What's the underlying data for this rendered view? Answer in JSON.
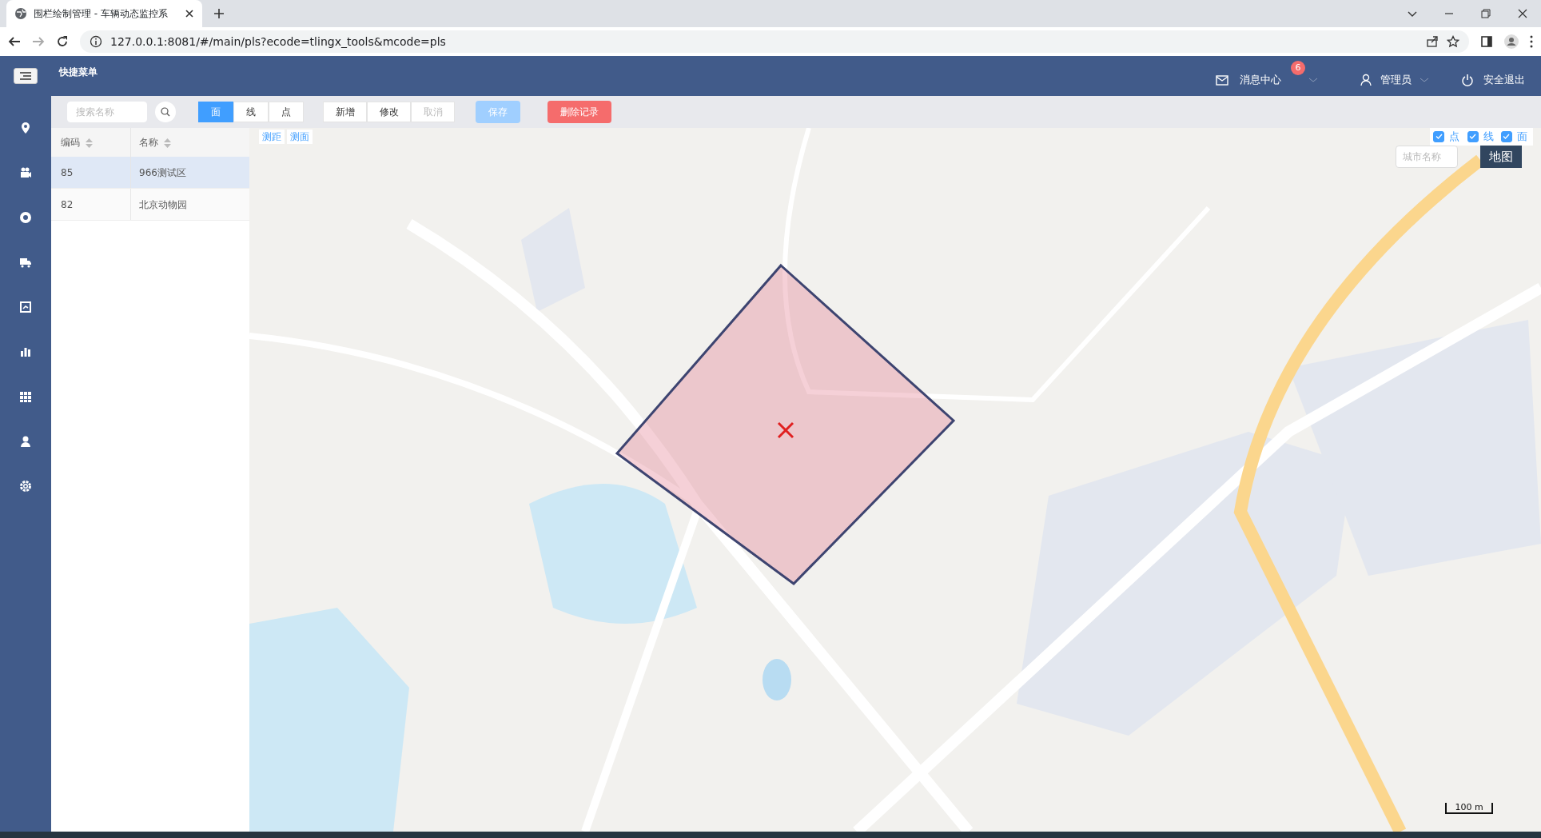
{
  "browser": {
    "tab_title": "围栏绘制管理 - 车辆动态监控系",
    "url": "127.0.0.1:8081/#/main/pls?ecode=tlingx_tools&mcode=pls"
  },
  "header": {
    "menu_title": "快捷菜单",
    "messages": {
      "label": "消息中心",
      "badge": "6"
    },
    "user": "管理员",
    "logout": "安全退出"
  },
  "toolbar": {
    "search": {
      "placeholder": "搜索名称"
    },
    "modes": [
      {
        "label": "面",
        "selected": true
      },
      {
        "label": "线",
        "selected": false
      },
      {
        "label": "点",
        "selected": false
      }
    ],
    "actions": [
      {
        "label": "新增",
        "disabled": false
      },
      {
        "label": "修改",
        "disabled": false
      },
      {
        "label": "取消",
        "disabled": true
      }
    ],
    "save": {
      "label": "保存",
      "disabled": true
    },
    "delete": {
      "label": "删除记录"
    }
  },
  "table": {
    "columns": [
      "编码",
      "名称"
    ],
    "rows": [
      {
        "cells": [
          "85",
          "966测试区"
        ],
        "selected": true
      },
      {
        "cells": [
          "82",
          "北京动物园"
        ],
        "selected": false
      }
    ]
  },
  "map": {
    "tools": [
      "测距",
      "测面"
    ],
    "layers": [
      {
        "label": "点",
        "checked": true
      },
      {
        "label": "线",
        "checked": true
      },
      {
        "label": "面",
        "checked": true
      }
    ],
    "city_search": {
      "placeholder": "城市名称"
    },
    "map_type": "地图",
    "scale": "100 m"
  }
}
